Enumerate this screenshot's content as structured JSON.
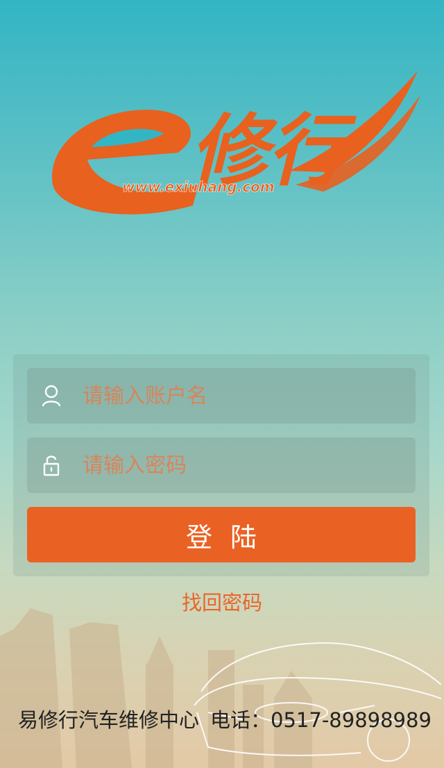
{
  "logo": {
    "brand_text": "修行",
    "url_text": "www.exiuhang.com",
    "color": "#e8611f"
  },
  "login": {
    "username_placeholder": "请输入账户名",
    "password_placeholder": "请输入密码",
    "submit_label": "登陆",
    "user_icon": "user-icon",
    "lock_icon": "lock-icon"
  },
  "forgot_password_label": "找回密码",
  "footer": {
    "company": "易修行汽车维修中心",
    "phone_label": "电话：",
    "phone_number": "0517-89898989"
  },
  "colors": {
    "accent": "#ea6223",
    "bg_top": "#33b5c4",
    "bg_bottom": "#e3c9a6"
  }
}
